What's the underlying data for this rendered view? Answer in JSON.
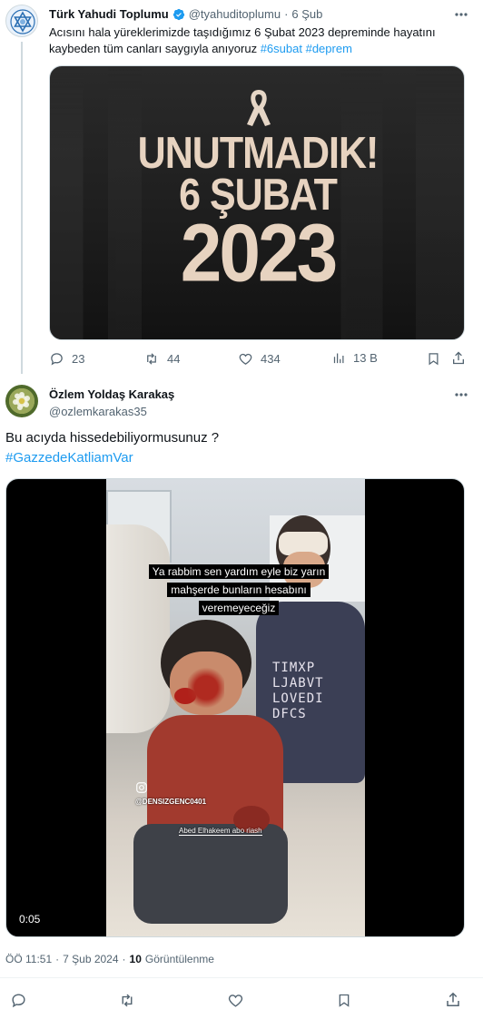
{
  "quoted_tweet": {
    "author_name": "Türk Yahudi Toplumu",
    "handle": "@tyahuditoplumu",
    "separator": "·",
    "date": "6 Şub",
    "text": "Acısını hala yüreklerimizde  taşıdığımız 6 Şubat 2023 depreminde hayatını kaybeden tüm canları saygıyla anıyoruz",
    "hashtags": [
      "#6subat",
      "#deprem"
    ],
    "image": {
      "line1": "UNUTMADIK!",
      "line2": "6 ŞUBAT",
      "line3": "2023"
    },
    "stats": {
      "replies": "23",
      "reposts": "44",
      "likes": "434",
      "views": "13 B"
    }
  },
  "main_tweet": {
    "author_name": "Özlem Yoldaş Karakaş",
    "handle": "@ozlemkarakas35",
    "text": "Bu acıyda hissedebiliyormusunuz ?",
    "hashtag": "#GazzedeKatliamVar",
    "video": {
      "caption_line1": "Ya rabbim sen yardım eyle biz yarın",
      "caption_line2": "mahşerde bunların hesabını",
      "caption_line3": "veremeyeceğiz",
      "watermark": "@DENSIZGENC0401",
      "credit": "Abed Elhakeem abo riash",
      "duration": "0:05",
      "shirt_text1": "TIMXP",
      "shirt_text2": "LJABVT",
      "shirt_text3": "LOVEDI",
      "shirt_text4": "DFCS"
    },
    "meta": {
      "time": "ÖÖ 11:51",
      "dot": "·",
      "date": "7 Şub 2024",
      "views_count": "10",
      "views_label": "Görüntülenme"
    }
  }
}
